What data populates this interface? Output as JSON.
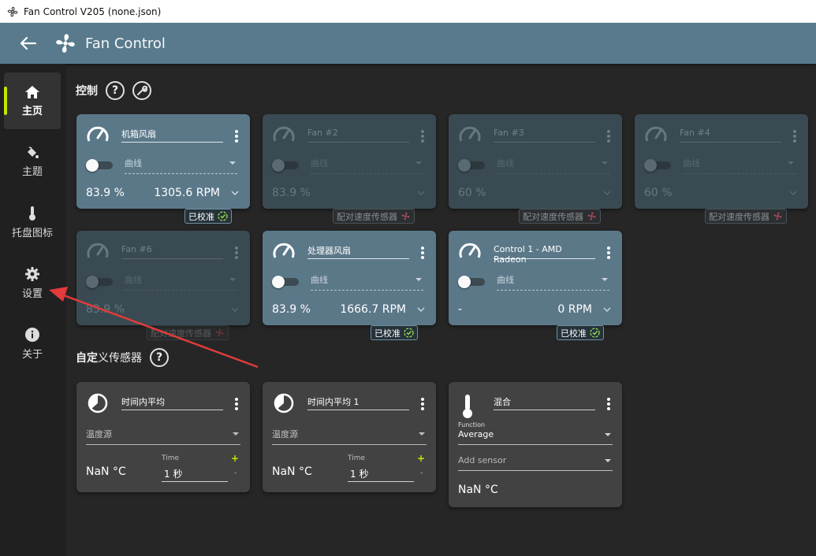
{
  "window": {
    "title": "Fan Control V205 (none.json)"
  },
  "header": {
    "title": "Fan Control",
    "back_icon": "arrow-left-icon",
    "logo_icon": "fan-icon"
  },
  "sidebar": {
    "accent": "#c6e600",
    "items": [
      {
        "label": "主页",
        "icon": "home-icon",
        "active": true
      },
      {
        "label": "主题",
        "icon": "paint-bucket-icon",
        "active": false
      },
      {
        "label": "托盘图标",
        "icon": "thermometer-icon",
        "active": false
      },
      {
        "label": "设置",
        "icon": "gear-icon",
        "active": false
      },
      {
        "label": "关于",
        "icon": "info-icon",
        "active": false
      }
    ]
  },
  "controls": {
    "title": "控制",
    "help_icon": "help-icon",
    "tool_icon": "wrench-icon",
    "cards": [
      {
        "name": "机箱风扇",
        "curve": "曲线",
        "percent": "83.9 %",
        "rpm": "1305.6 RPM",
        "badge": "已校准",
        "badge_type": "calibrated",
        "dim": false
      },
      {
        "name": "Fan #2",
        "curve": "曲线",
        "percent": "83.9 %",
        "rpm": "",
        "badge": "配对速度传感器",
        "badge_type": "pair",
        "dim": true
      },
      {
        "name": "Fan #3",
        "curve": "曲线",
        "percent": "60 %",
        "rpm": "",
        "badge": "配对速度传感器",
        "badge_type": "pair",
        "dim": true
      },
      {
        "name": "Fan #4",
        "curve": "曲线",
        "percent": "60 %",
        "rpm": "",
        "badge": "配对速度传感器",
        "badge_type": "pair",
        "dim": true
      },
      {
        "name": "Fan #6",
        "curve": "曲线",
        "percent": "83.9 %",
        "rpm": "",
        "badge": "配对速度传感器",
        "badge_type": "pair",
        "dim": true
      },
      {
        "name": "处理器风扇",
        "curve": "曲线",
        "percent": "83.9 %",
        "rpm": "1666.7 RPM",
        "badge": "已校准",
        "badge_type": "calibrated",
        "dim": false
      },
      {
        "name": "Control 1 - AMD Radeon",
        "curve": "曲线",
        "percent": "-",
        "rpm": "0 RPM",
        "badge": "已校准",
        "badge_type": "calibrated",
        "dim": false
      }
    ]
  },
  "custom_sensors": {
    "title_bold": "自定",
    "title_rest": "义传感器",
    "help_icon": "help-icon",
    "cards": [
      {
        "name": "时间内平均",
        "source": "温度源",
        "value": "NaN °C",
        "time_label": "Time",
        "time_value": "1 秒"
      },
      {
        "name": "时间内平均 1",
        "source": "温度源",
        "value": "NaN °C",
        "time_label": "Time",
        "time_value": "1 秒"
      }
    ],
    "mix": {
      "name": "混合",
      "function_label": "Function",
      "function_value": "Average",
      "add_sensor": "Add sensor",
      "value": "NaN °C"
    }
  },
  "colors": {
    "card_active": "#5b7889",
    "card_dim": "#3a4a52",
    "card_dark": "#424242",
    "header": "#587a8c",
    "annotation_arrow": "#e23b3b"
  }
}
